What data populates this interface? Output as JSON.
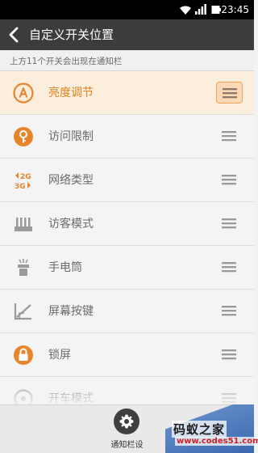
{
  "status_bar": {
    "time": "23:45"
  },
  "header": {
    "title": "自定义开关位置"
  },
  "hint": "上方11个开关会出现在通知栏",
  "items": [
    {
      "label": "亮度调节",
      "icon": "brightness-icon",
      "active": true
    },
    {
      "label": "访问限制",
      "icon": "access-restriction-icon",
      "active": false
    },
    {
      "label": "网络类型",
      "icon": "network-type-icon",
      "active": false
    },
    {
      "label": "访客模式",
      "icon": "guest-mode-icon",
      "active": false
    },
    {
      "label": "手电筒",
      "icon": "flashlight-icon",
      "active": false
    },
    {
      "label": "屏幕按键",
      "icon": "screen-buttons-icon",
      "active": false
    },
    {
      "label": "锁屏",
      "icon": "lock-icon",
      "active": false
    },
    {
      "label": "开车模式",
      "icon": "drive-mode-icon",
      "active": false
    }
  ],
  "bottom": {
    "label": "通知栏设"
  },
  "watermark": {
    "text1": "码蚁之家",
    "text2": "www.codes51.com"
  },
  "colors": {
    "accent": "#e8852a",
    "header_bg": "#3c3c3c",
    "icon_gray": "#9a9a9a"
  }
}
